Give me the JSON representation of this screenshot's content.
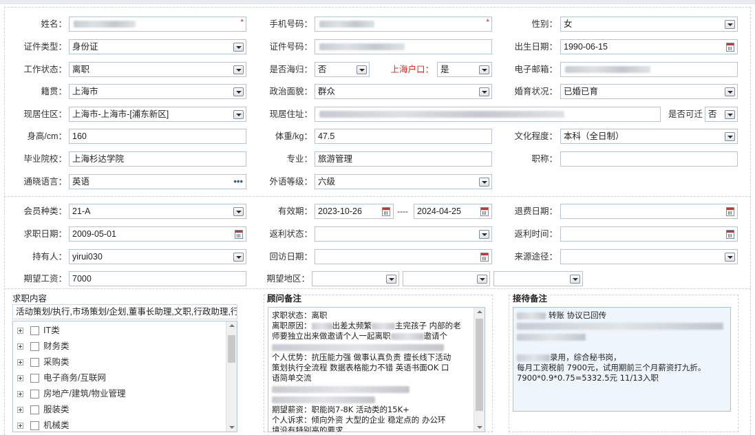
{
  "form": {
    "name": {
      "label": "姓名：",
      "value": ""
    },
    "phone": {
      "label": "手机号码：",
      "value": ""
    },
    "gender": {
      "label": "性别：",
      "value": "女"
    },
    "id_type": {
      "label": "证件类型：",
      "value": "身份证"
    },
    "id_no": {
      "label": "证件号码：",
      "value": ""
    },
    "birth": {
      "label": "出生日期：",
      "value": "1990-06-15"
    },
    "work_status": {
      "label": "工作状态：",
      "value": "离职"
    },
    "returnee": {
      "label": "是否海归：",
      "value": "否"
    },
    "sh_hukou": {
      "label": "上海户口：",
      "value": "是"
    },
    "email": {
      "label": "电子邮箱：",
      "value": ""
    },
    "origin": {
      "label": "籍贯：",
      "value": "上海市"
    },
    "politics": {
      "label": "政治面貌：",
      "value": "群众"
    },
    "marital": {
      "label": "婚育状况：",
      "value": "已婚已育"
    },
    "residence_area": {
      "label": "现居住区：",
      "value": "上海市-上海市-[浦东新区]"
    },
    "address": {
      "label": "现居住址：",
      "value": ""
    },
    "relocate": {
      "label": "是否可迁",
      "value": "否"
    },
    "height": {
      "label": "身高/cm：",
      "value": "160"
    },
    "weight": {
      "label": "体重/kg：",
      "value": "47.5"
    },
    "education": {
      "label": "文化程度：",
      "value": "本科（全日制）"
    },
    "school": {
      "label": "毕业院校：",
      "value": "上海杉达学院"
    },
    "major": {
      "label": "专业：",
      "value": "旅游管理"
    },
    "title": {
      "label": "职称：",
      "value": ""
    },
    "language": {
      "label": "通晓语言：",
      "value": "英语",
      "more": "•••"
    },
    "foreign_level": {
      "label": "外语等级：",
      "value": "六级"
    }
  },
  "member": {
    "type": {
      "label": "会员种类：",
      "value": "21-A"
    },
    "valid": {
      "label": "有效期：",
      "from": "2023-10-26",
      "sep": "----",
      "to": "2024-04-25"
    },
    "refund_date": {
      "label": "退费日期：",
      "value": ""
    },
    "job_date": {
      "label": "求职日期：",
      "value": "2009-05-01"
    },
    "rebate_status": {
      "label": "返利状态：",
      "value": ""
    },
    "rebate_time": {
      "label": "返利时间：",
      "value": ""
    },
    "holder": {
      "label": "持有人：",
      "value": "yirui030"
    },
    "visit_date": {
      "label": "回访日期：",
      "value": ""
    },
    "source": {
      "label": "来源途径：",
      "value": ""
    },
    "salary": {
      "label": "期望工资：",
      "value": "7000"
    },
    "region": {
      "label": "期望地区：",
      "values": [
        "",
        "",
        ""
      ]
    }
  },
  "job_content": {
    "title": "求职内容",
    "value": "活动策划/执行,市场策划/企划,董事长助理,文职,行政助理,行",
    "tree": [
      "IT类",
      "财务类",
      "采购类",
      "电子商务/互联网",
      "房地产/建筑/物业管理",
      "服装类",
      "机械类"
    ]
  },
  "advisor_note": {
    "title": "顾问备注",
    "lines": [
      "求职状态：离职",
      "离职原因：",
      "出差太频繁",
      "主完孩子 内部的老",
      "师要独立出来做邀请个人一起离职",
      "邀请个",
      "个人优势：抗压能力强 做事认真负责 擅长线下活动",
      "策划执行全流程  数据表格能力不错 英语书面OK 口",
      "语简单交流",
      "期望薪资：职能岗7-8K  活动类的15K+",
      "个人诉求：倾向外资 大型的企业 稳定点的 办公环",
      "境没有特别高的要求"
    ]
  },
  "reception_note": {
    "title": "接待备注",
    "lines": [
      "转账 协议已回传",
      "录用，综合秘书岗，",
      "每月工资税前 7900元，试用期前三个月薪资打九折。",
      "7900*0.9*0.75=5332.5元 11/13入职"
    ]
  }
}
